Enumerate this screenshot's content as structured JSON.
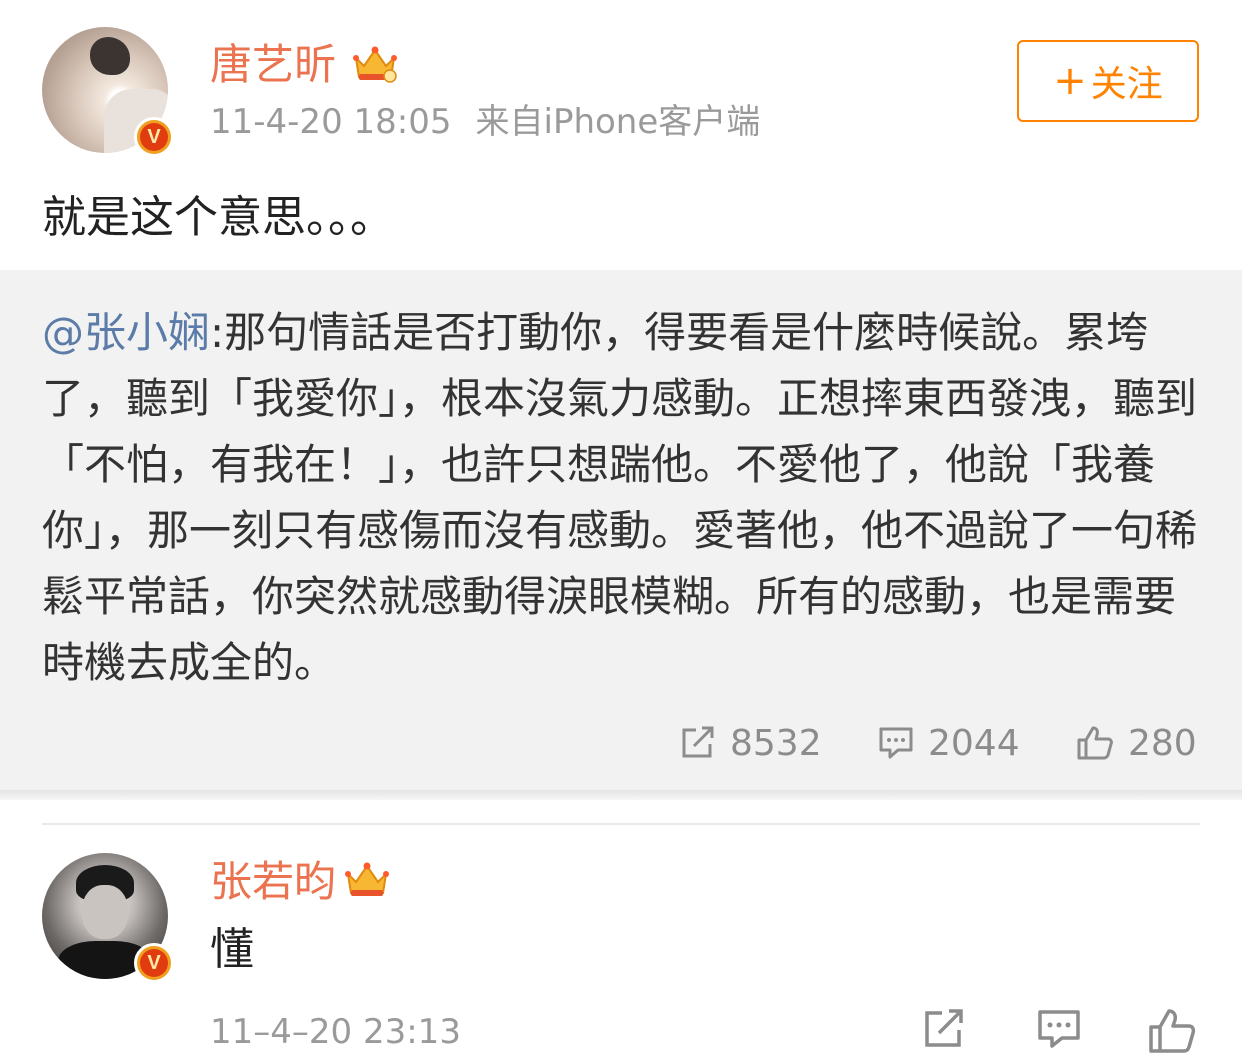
{
  "post": {
    "username": "唐艺昕",
    "time": "11-4-20 18:05",
    "source": "来自iPhone客户端",
    "follow_label": "关注",
    "text": "就是这个意思。。。"
  },
  "repost": {
    "mention": "@张小娴",
    "text": ":那句情話是否打動你，得要看是什麼時候說。累垮了，聽到「我愛你」，根本沒氣力感動。正想摔東西發洩，聽到「不怕，有我在！」，也許只想踹他。不愛他了，他說「我養你」，那一刻只有感傷而沒有感動。愛著他，他不過說了一句稀鬆平常話，你突然就感動得淚眼模糊。所有的感動，也是需要時機去成全的。",
    "stats": {
      "reposts": "8532",
      "comments": "2044",
      "likes": "280"
    }
  },
  "comment": {
    "username": "张若昀",
    "text": "懂",
    "time": "11–4–20 23:13"
  },
  "icons": {
    "verified_badge": "v-badge-icon",
    "crown": "crown-icon",
    "repost": "share-icon",
    "comment": "comment-icon",
    "like": "thumbs-up-icon"
  },
  "colors": {
    "username": "#eb7350",
    "follow": "#ff8200",
    "mention": "#5b7ca8",
    "verified": "#e03c10"
  }
}
